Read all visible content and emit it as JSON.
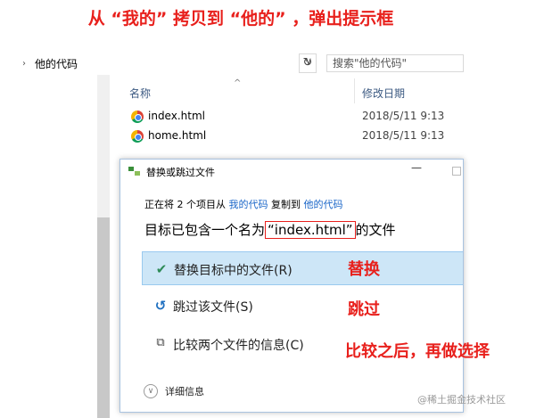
{
  "annotation": {
    "heading": "从 “我的” 拷贝到 “他的” ，弹出提示框",
    "replace": "替换",
    "skip": "跳过",
    "compare": "比较之后，再做选择",
    "color": "#e8201c"
  },
  "explorer": {
    "address": "他的代码",
    "search_placeholder": "搜索\"他的代码\"",
    "columns": {
      "name": "名称",
      "date": "修改日期"
    },
    "files": [
      {
        "name": "index.html",
        "date": "2018/5/11 9:13",
        "icon": "chrome-html-icon"
      },
      {
        "name": "home.html",
        "date": "2018/5/11 9:13",
        "icon": "chrome-html-icon"
      }
    ]
  },
  "dialog": {
    "title": "替换或跳过文件",
    "info": {
      "prefix": "正在将 2 个项目从",
      "from": "我的代码",
      "mid": "复制到",
      "to": "他的代码"
    },
    "target": {
      "prefix": "目标已包含一个名为",
      "filename": "“index.html”",
      "suffix": "的文件"
    },
    "options": {
      "replace": "替换目标中的文件(R)",
      "skip": "跳过该文件(S)",
      "compare": "比较两个文件的信息(C)"
    },
    "details": "详细信息",
    "link_color": "#1a66c8",
    "selected_color": "#cde6f7"
  },
  "watermark": "@稀土掘金技术社区"
}
